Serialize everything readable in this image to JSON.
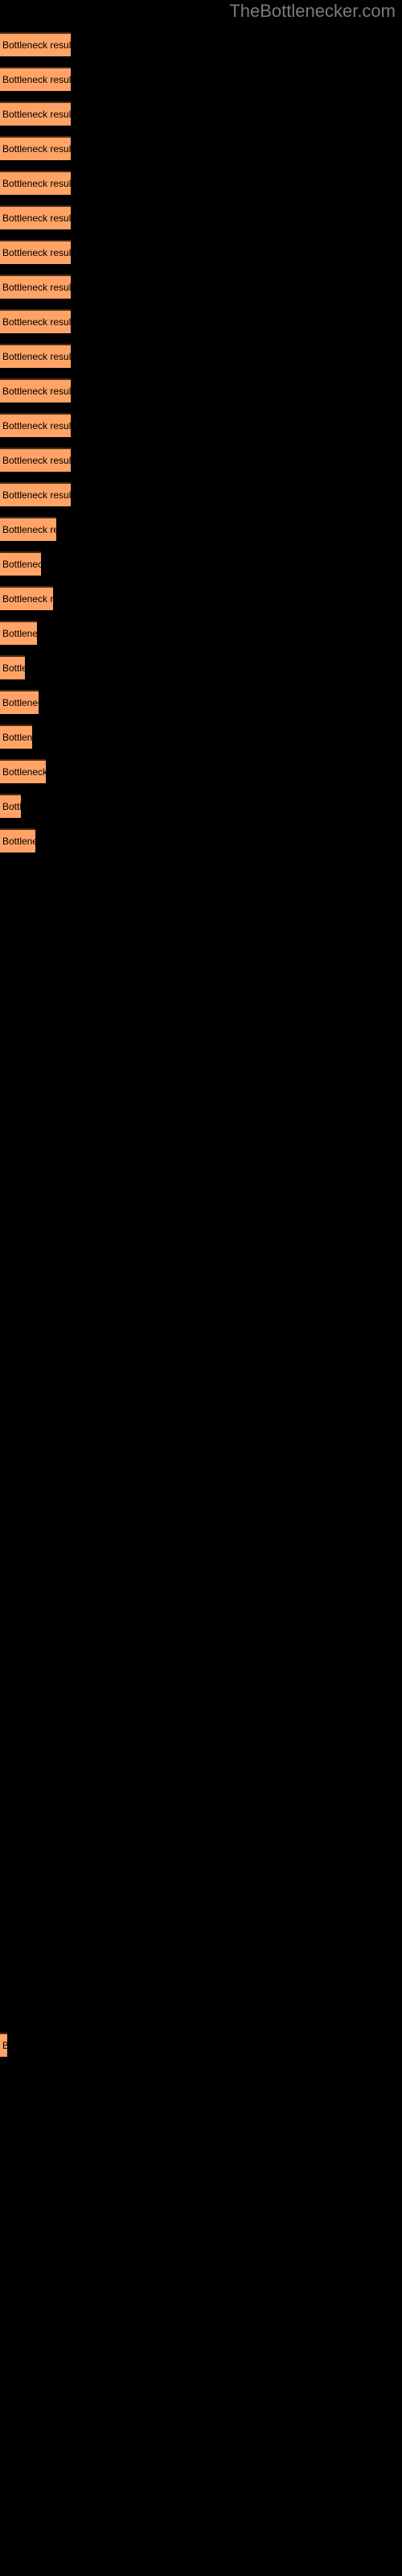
{
  "header": {
    "brand": "TheBottlenecker.com",
    "brand_color": "#7a7a7a"
  },
  "colors": {
    "background": "#000000",
    "bar_fill": "#ffa366",
    "bar_border": "#4a2c14",
    "label_text": "#000000"
  },
  "chart_data": {
    "type": "bar",
    "orientation": "horizontal",
    "title": "",
    "xlabel": "",
    "ylabel": "",
    "grid": false,
    "legend": false,
    "bar_label_text": "Bottleneck result",
    "xlim": [
      0,
      88
    ],
    "bars": [
      {
        "label": "Bottleneck result",
        "value": 88,
        "y": 40
      },
      {
        "label": "Bottleneck result",
        "value": 88,
        "y": 83
      },
      {
        "label": "Bottleneck result",
        "value": 88,
        "y": 126
      },
      {
        "label": "Bottleneck result",
        "value": 88,
        "y": 169
      },
      {
        "label": "Bottleneck result",
        "value": 88,
        "y": 212
      },
      {
        "label": "Bottleneck result",
        "value": 88,
        "y": 255
      },
      {
        "label": "Bottleneck result",
        "value": 88,
        "y": 298
      },
      {
        "label": "Bottleneck result",
        "value": 88,
        "y": 341
      },
      {
        "label": "Bottleneck result",
        "value": 88,
        "y": 384
      },
      {
        "label": "Bottleneck result",
        "value": 88,
        "y": 427
      },
      {
        "label": "Bottleneck result",
        "value": 88,
        "y": 470
      },
      {
        "label": "Bottleneck result",
        "value": 88,
        "y": 513
      },
      {
        "label": "Bottleneck result",
        "value": 88,
        "y": 556
      },
      {
        "label": "Bottleneck result",
        "value": 88,
        "y": 599
      },
      {
        "label": "Bottleneck res",
        "value": 70,
        "y": 642
      },
      {
        "label": "Bottlenec",
        "value": 51,
        "y": 685
      },
      {
        "label": "Bottleneck re",
        "value": 66,
        "y": 728
      },
      {
        "label": "Bottlene",
        "value": 46,
        "y": 771
      },
      {
        "label": "Bottl",
        "value": 31,
        "y": 814
      },
      {
        "label": "Bottlene",
        "value": 48,
        "y": 857
      },
      {
        "label": "Bottlen",
        "value": 40,
        "y": 900
      },
      {
        "label": "Bottleneck",
        "value": 57,
        "y": 943
      },
      {
        "label": "Bott",
        "value": 26,
        "y": 986
      },
      {
        "label": "Bottlene",
        "value": 44,
        "y": 1029
      },
      {
        "label": "B",
        "value": 9,
        "y": 2525
      }
    ]
  }
}
